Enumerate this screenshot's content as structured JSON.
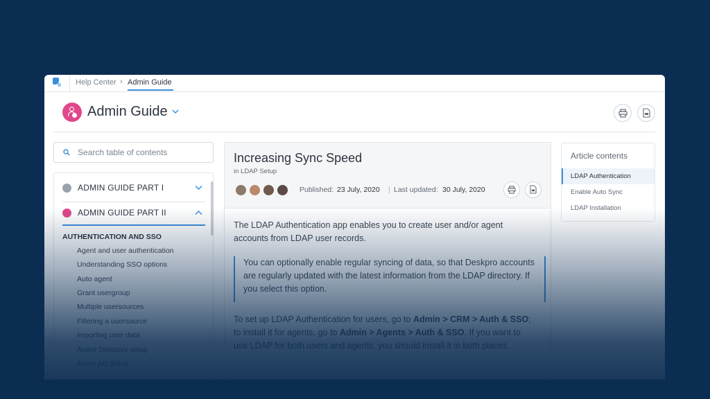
{
  "breadcrumb": {
    "home": "Help Center",
    "separator": "›",
    "current": "Admin Guide"
  },
  "header": {
    "title": "Admin Guide"
  },
  "search": {
    "placeholder": "Search table of contents"
  },
  "toc": {
    "parts": [
      {
        "label": "ADMIN GUIDE PART I",
        "expanded": false
      },
      {
        "label": "ADMIN GUIDE PART II",
        "expanded": true
      }
    ],
    "section": "AUTHENTICATION AND SSO",
    "items": [
      "Agent and user authentication",
      "Understanding SSO options",
      "Auto agent",
      "Grant usergroup",
      "Multiple usersources",
      "Filtering a usersource",
      "Importing user data",
      "Active Directory setup",
      "Azure AD Setup"
    ]
  },
  "article": {
    "title": "Increasing Sync Speed",
    "subtitle": "in LDAP Setup",
    "published_label": "Published:",
    "published_date": "23 July, 2020",
    "meta_sep": "|",
    "updated_label": "Last updated:",
    "updated_date": "30 July, 2020",
    "intro_1": "The LDAP Authentication app enables you to create user and/or agent",
    "intro_2": "accounts from LDAP user records.",
    "callout": "You can optionally enable regular syncing of data, so that Deskpro accounts are regularly updated with the latest information from the LDAP directory. If you select this option.",
    "p2_1a": "To set up LDAP Authentication for users, go to ",
    "p2_1b": "Admin > CRM > Auth & SSO",
    "p2_1c": ";",
    "p2_2a": "to install it for agents, go to ",
    "p2_2b": "Admin > Agents > Auth & SSO",
    "p2_2c": ". If you want to",
    "p2_3": "use LDAP for both users and agents, you should install it in both places."
  },
  "contents": {
    "title": "Article contents",
    "items": [
      "LDAP Authentication",
      "Enable Auto Sync",
      "LDAP Installation"
    ],
    "active_index": 0
  },
  "colors": {
    "background": "#0c2d52",
    "accent": "#3b8fd9",
    "brand_pink": "#e0488b",
    "part_one_icon": "#9aa3ad"
  },
  "icons": [
    "deskpro-logo-icon",
    "admin-guide-icon",
    "chevron-down-icon",
    "print-icon",
    "pdf-icon",
    "search-icon",
    "chevron-up-icon"
  ]
}
